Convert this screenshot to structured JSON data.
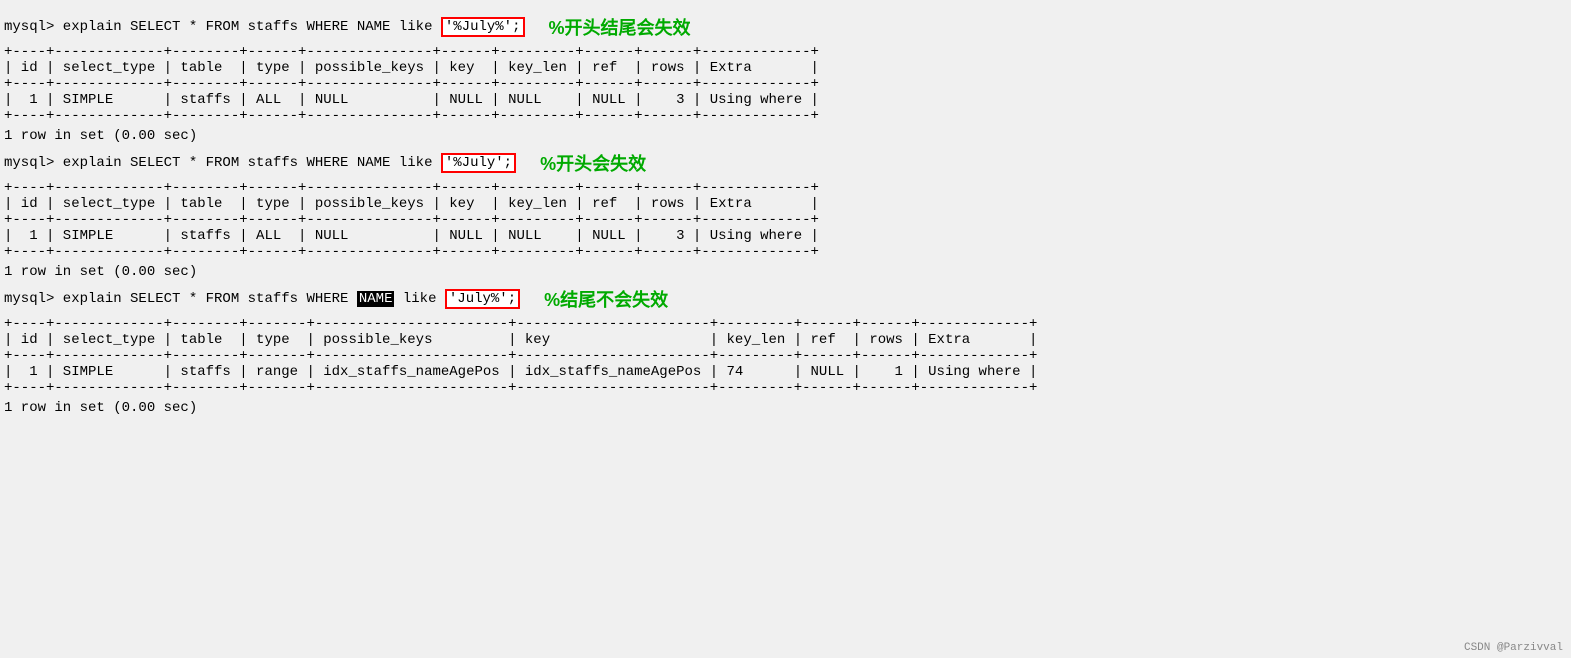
{
  "sections": [
    {
      "id": "section1",
      "query_prefix": "mysql> explain SELECT * FROM staffs WHERE NAME like ",
      "query_highlight": "'%July%';",
      "highlight_type": "red",
      "annotation": "%开头结尾会失效",
      "sep1": "+----|-------------|--------|------|--------------|------|---------|------|------|------------|",
      "header": "| id | select_type | table  | type | possible_keys | key  | key_len | ref  | rows | Extra      |",
      "sep2": "+----|-------------|--------|------|--------------|------|---------|------|------|------------|",
      "datarow": "| 1  | SIMPLE      | staffs | ALL  | NULL          | NULL | NULL    | NULL |    3 | Using where |",
      "sep3": "+----|-------------|--------|------|--------------|------|---------|------|------|------------|",
      "rowcount": "1 row in set (0.00 sec)"
    },
    {
      "id": "section2",
      "query_prefix": "mysql> explain SELECT * FROM staffs WHERE NAME like ",
      "query_highlight": "'%July';",
      "highlight_type": "red",
      "annotation": "%开头会失效",
      "sep1": "+----|-------------|--------|------|--------------|------|---------|------|------|------------|",
      "header": "| id | select_type | table  | type | possible_keys | key  | key_len | ref  | rows | Extra      |",
      "sep2": "+----|-------------|--------|------|--------------|------|---------|------|------|------------|",
      "datarow": "| 1  | SIMPLE      | staffs | ALL  | NULL          | NULL | NULL    | NULL |    3 | Using where |",
      "sep3": "+----|-------------|--------|------|--------------|------|---------|------|------|------------|",
      "rowcount": "1 row in set (0.00 sec)"
    },
    {
      "id": "section3",
      "query_prefix1": "mysql> explain SELECT * FROM staffs WHERE ",
      "query_name_highlight": "NAME",
      "query_prefix2": " like ",
      "query_highlight": "'July%';",
      "highlight_type": "red",
      "annotation": "%结尾不会失效",
      "sep1": "+-----|--------------|--------|-------|----------------------|----------------------|---------|------|------|------------|",
      "header": "| id  | select_type  | table  | type  | possible_keys        | key                  | key_len | ref  | rows | Extra      |",
      "sep2": "+-----|--------------|--------|-------|----------------------|----------------------|---------|------|------|------------|",
      "datarow": "| 1   | SIMPLE       | staffs | range | idx_staffs_nameAgePos | idx_staffs_nameAgePos | 74      | NULL |    1 | Using where |",
      "sep3": "+-----|--------------|--------|-------|----------------------|----------------------|---------|------|------|------------|",
      "rowcount": "1 row in set (0.00 sec)"
    }
  ],
  "watermark": "CSDN @Parzivval"
}
